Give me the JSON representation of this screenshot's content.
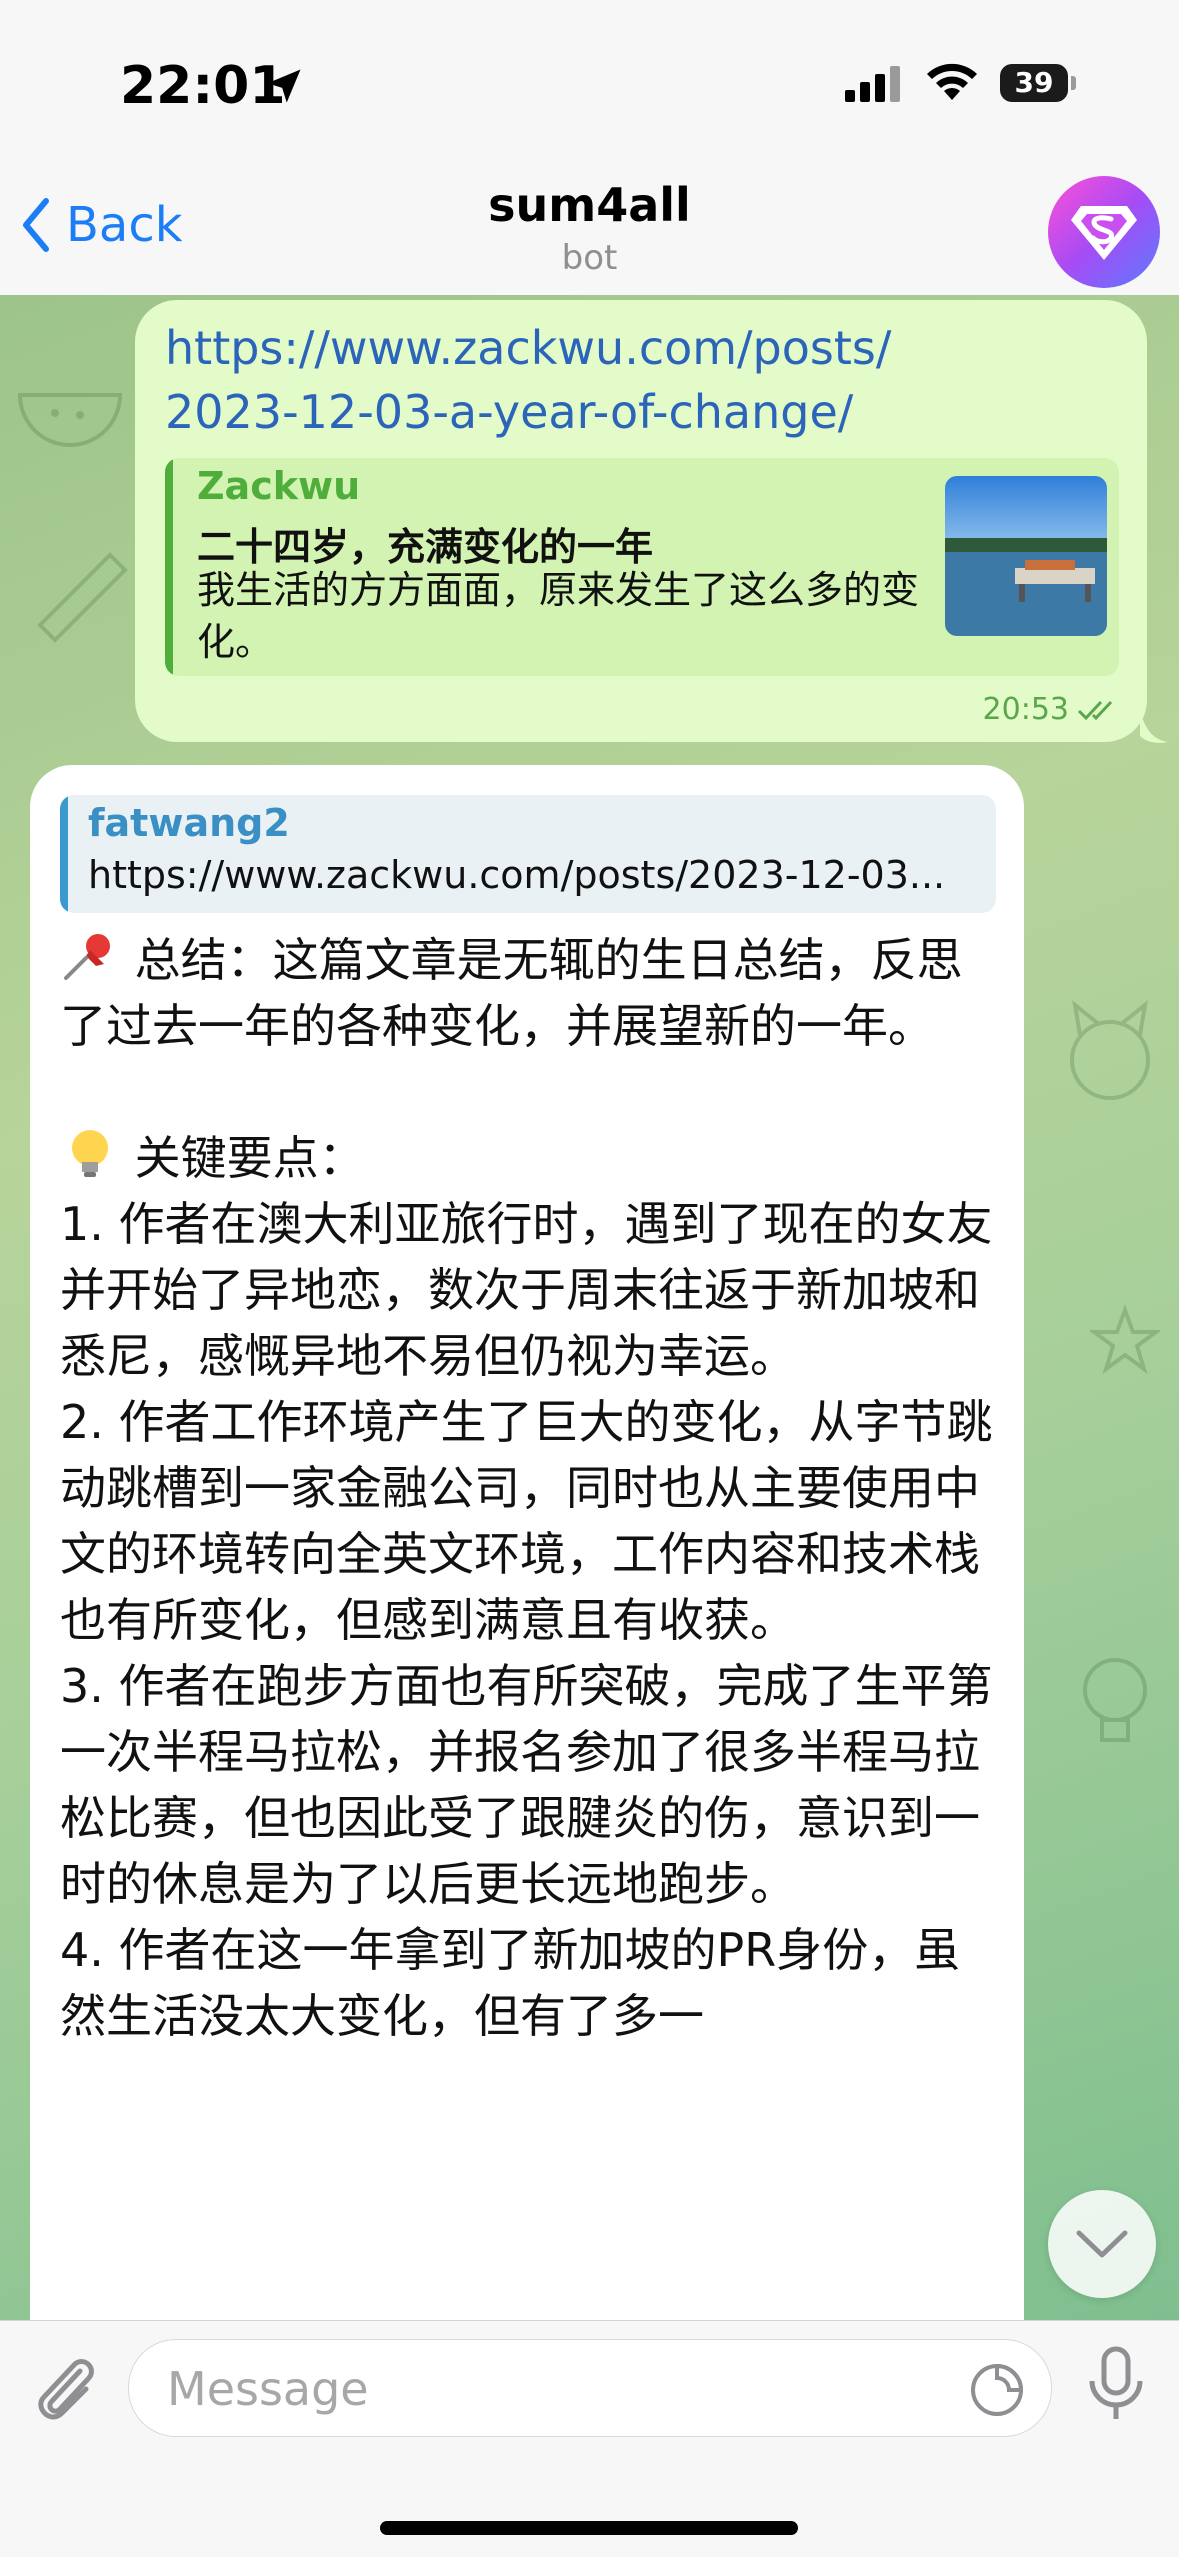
{
  "status_bar": {
    "time": "22:01",
    "battery": "39"
  },
  "nav": {
    "back_label": "Back",
    "title": "sum4all",
    "subtitle": "bot"
  },
  "outgoing_message": {
    "link_line1": "https://www.zackwu.com/posts/",
    "link_line2": "2023-12-03-a-year-of-change/",
    "preview": {
      "site": "Zackwu",
      "title": "二十四岁，充满变化的一年",
      "description": "我生活的方方面面，原来发生了这么多的变化。"
    },
    "time": "20:53"
  },
  "incoming_message": {
    "reply": {
      "name": "fatwang2",
      "text": "https://www.zackwu.com/posts/2023-12-03..."
    },
    "summary": "总结：这篇文章是无辄的生日总结，反思了过去一年的各种变化，并展望新的一年。",
    "key_points_header": "关键要点：",
    "points": [
      "1. 作者在澳大利亚旅行时，遇到了现在的女友并开始了异地恋，数次于周末往返于新加坡和悉尼，感慨异地不易但仍视为幸运。",
      "2. 作者工作环境产生了巨大的变化，从字节跳动跳槽到一家金融公司，同时也从主要使用中文的环境转向全英文环境，工作内容和技术栈也有所变化，但感到满意且有收获。",
      "3. 作者在跑步方面也有所突破，完成了生平第一次半程马拉松，并报名参加了很多半程马拉松比赛，但也因此受了跟腱炎的伤，意识到一时的休息是为了以后更长远地跑步。",
      "4. 作者在这一年拿到了新加坡的PR身份，虽然生活没太大变化，但有了多一"
    ]
  },
  "input": {
    "placeholder": "Message"
  }
}
